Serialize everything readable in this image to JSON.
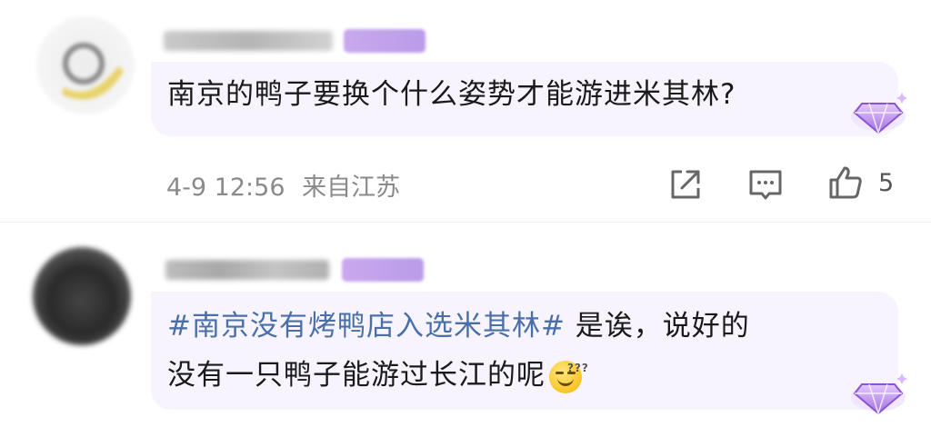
{
  "comments": [
    {
      "text": "南京的鸭子要换个什么姿势才能游进米其林?",
      "time": "4-9 12:56",
      "location": "来自江苏",
      "likes": "5"
    },
    {
      "hashtag": "#南京没有烤鸭店入选米其林#",
      "text_line1": " 是诶，说好的",
      "text_line2": "没有一只鸭子能游过长江的呢"
    }
  ],
  "icons": {
    "share": "share-icon",
    "reply": "comment-icon",
    "like": "thumbs-up-icon",
    "badge": "diamond-badge-icon"
  },
  "colors": {
    "bubble": "#f7f4fd",
    "hashtag": "#4a6fa8",
    "meta": "#8a8a8a",
    "badge": "#b99be8"
  }
}
